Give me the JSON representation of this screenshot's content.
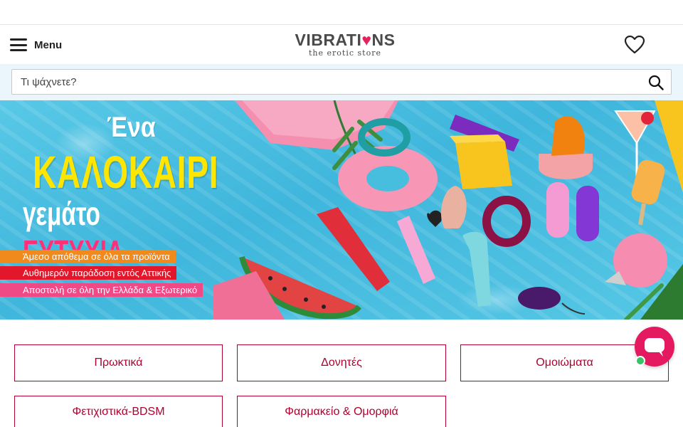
{
  "header": {
    "menu_label": "Menu",
    "logo": {
      "word_start": "VIBRATI",
      "word_heart": "♥",
      "word_end": "NS",
      "tagline": "the erotic store"
    }
  },
  "search": {
    "placeholder": "Τι ψάχνετε?",
    "value": ""
  },
  "banner": {
    "line1": "Ένα",
    "line2": "ΚΑΛΟΚΑΙΡΙ",
    "line3_white": "γεμάτο",
    "line3_pink": "ΕΥΤΥΧΙΑ",
    "promos": [
      "Άμεσο απόθεμα σε όλα τα προϊόντα",
      "Αυθημερόν παράδοση εντός Αττικής",
      "Αποστολή σε όλη την Ελλάδα & Εξωτερικό"
    ]
  },
  "categories": [
    "Πρωκτικά",
    "Δονητές",
    "Ομοιώματα",
    "Φετιχιστικά-BDSM",
    "Φαρμακείο & Ομορφιά"
  ],
  "colors": {
    "brand": "#e0245e",
    "category_border": "#b0002e",
    "chat": "#e5195f",
    "online": "#39c26a",
    "search_bar_bg": "#eaf6fb"
  },
  "icons": {
    "menu": "hamburger-icon",
    "wishlist": "heart-icon",
    "search": "search-icon",
    "chat": "chat-bubble-icon"
  }
}
